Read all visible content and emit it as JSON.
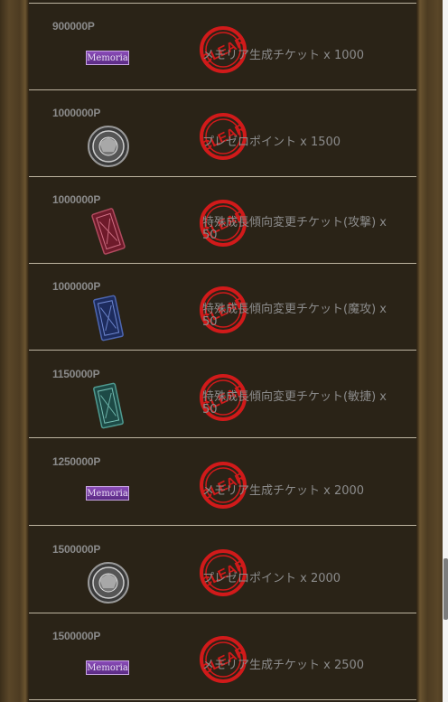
{
  "rows": [
    {
      "points": "900000P",
      "icon": "memoria-badge",
      "badge_text": "Memoria",
      "reward": "メモリア生成チケット x 1000",
      "stamp": "CLEAR"
    },
    {
      "points": "1000000P",
      "icon": "medal-icon",
      "reward": "プレゼロポイント x 1500",
      "stamp": "CLEAR"
    },
    {
      "points": "1000000P",
      "icon": "ticket-red-icon",
      "reward": "特殊成長傾向変更チケット(攻撃) x 50",
      "stamp": "CLEAR"
    },
    {
      "points": "1000000P",
      "icon": "ticket-blue-icon",
      "reward": "特殊成長傾向変更チケット(魔攻) x 50",
      "stamp": "CLEAR"
    },
    {
      "points": "1150000P",
      "icon": "ticket-teal-icon",
      "reward": "特殊成長傾向変更チケット(敏捷) x 50",
      "stamp": "CLEAR"
    },
    {
      "points": "1250000P",
      "icon": "memoria-badge",
      "badge_text": "Memoria",
      "reward": "メモリア生成チケット x 2000",
      "stamp": "CLEAR"
    },
    {
      "points": "1500000P",
      "icon": "medal-icon",
      "reward": "プレゼロポイント x 2000",
      "stamp": "CLEAR"
    },
    {
      "points": "1500000P",
      "icon": "memoria-badge",
      "badge_text": "Memoria",
      "reward": "メモリア生成チケット x 2500",
      "stamp": "CLEAR"
    }
  ],
  "colors": {
    "stamp": "#d11a1a",
    "points": "#8a8a8a",
    "text": "#8b8b8b",
    "divider": "#bdb4a0",
    "row_bg": "#2a2317",
    "frame": "#4a3a22"
  }
}
